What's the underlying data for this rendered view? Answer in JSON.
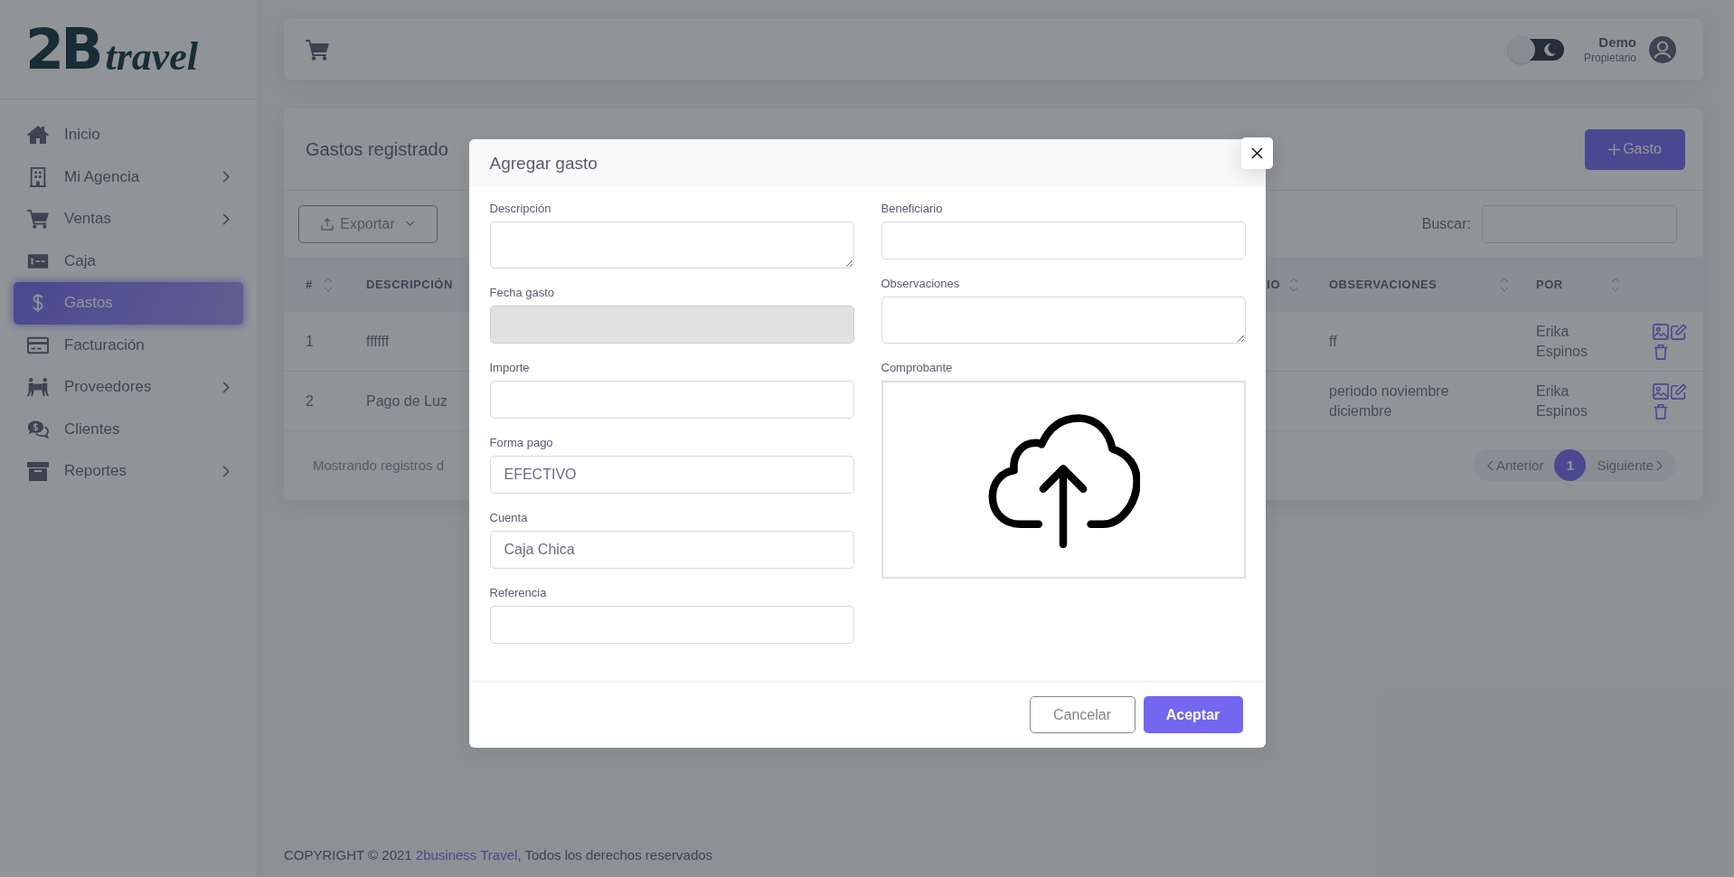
{
  "logo": {
    "mark": "2B",
    "wordmark": "travel"
  },
  "sidebar": {
    "items": [
      {
        "label": "Inicio",
        "expandable": false,
        "selected": false
      },
      {
        "label": "Mi Agencia",
        "expandable": true,
        "selected": false
      },
      {
        "label": "Ventas",
        "expandable": true,
        "selected": false
      },
      {
        "label": "Caja",
        "expandable": false,
        "selected": false
      },
      {
        "label": "Gastos",
        "expandable": false,
        "selected": true
      },
      {
        "label": "Facturación",
        "expandable": false,
        "selected": false
      },
      {
        "label": "Proveedores",
        "expandable": true,
        "selected": false
      },
      {
        "label": "Clientes",
        "expandable": false,
        "selected": false
      },
      {
        "label": "Reportes",
        "expandable": true,
        "selected": false
      }
    ]
  },
  "header": {
    "dark_mode": {
      "on": false
    },
    "user": {
      "name": "Demo",
      "role": "Propietario"
    }
  },
  "card": {
    "title": "Gastos registrado",
    "add_button": "Gasto",
    "export_button": "Exportar",
    "search_label": "Buscar:"
  },
  "table": {
    "columns": [
      {
        "label": "#",
        "sortable": true
      },
      {
        "label": "DESCRIPCIÓN",
        "sortable": false
      },
      {
        "label": "IO",
        "sortable": true
      },
      {
        "label": "OBSERVACIONES",
        "sortable": true
      },
      {
        "label": "POR",
        "sortable": true
      }
    ],
    "rows": [
      {
        "number": "1",
        "description": "ffffff",
        "observations": "ff",
        "by": "Erika Espinos"
      },
      {
        "number": "2",
        "description": "Pago de Luz",
        "observations": "periodo noviembre diciembre",
        "by": "Erika Espinos"
      }
    ],
    "info": "Mostrando registros d",
    "pagination": {
      "previous": "Anterior",
      "pages": [
        {
          "label": "1",
          "selected": true
        }
      ],
      "next": "Siguiente"
    }
  },
  "modal": {
    "title": "Agregar gasto",
    "left_fields": [
      {
        "label": "Descripción",
        "kind": "textarea"
      },
      {
        "label": "Fecha gasto",
        "kind": "input",
        "disabled": true
      },
      {
        "label": "Importe",
        "kind": "input",
        "disabled": false
      },
      {
        "label": "Forma pago",
        "kind": "input",
        "disabled": false,
        "value": "EFECTIVO"
      },
      {
        "label": "Cuenta",
        "kind": "input",
        "disabled": false,
        "value": "Caja Chica"
      },
      {
        "label": "Referencia",
        "kind": "input",
        "disabled": false
      }
    ],
    "right_fields": [
      {
        "label": "Beneficiario",
        "kind": "input",
        "disabled": false
      },
      {
        "label": "Observaciones",
        "kind": "textarea"
      },
      {
        "label": "Comprobante",
        "kind": "upload"
      }
    ],
    "cancel_button": "Cancelar",
    "accept_button": "Aceptar"
  },
  "footer": {
    "copyright": "COPYRIGHT © 2021 ",
    "link": "2business Travel",
    "rest": ", Todos los derechos reservados"
  }
}
